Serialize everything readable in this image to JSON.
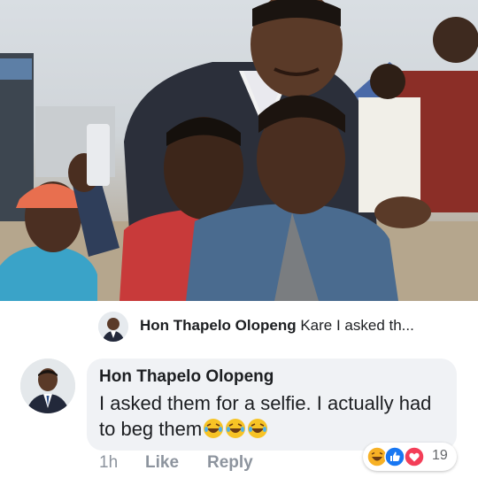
{
  "photo": {
    "icon": "selfie-photo"
  },
  "preview": {
    "author": "Hon Thapelo Olopeng",
    "snippet": "Kare I asked th..."
  },
  "comment": {
    "author": "Hon Thapelo Olopeng",
    "text": "I asked them for a selfie. I actually had to beg them",
    "emoji": [
      "laughing-emoji",
      "laughing-emoji",
      "laughing-emoji"
    ]
  },
  "actions": {
    "time": "1h",
    "like": "Like",
    "reply": "Reply"
  },
  "reactions": {
    "icons": [
      "haha-reaction-icon",
      "like-reaction-icon",
      "love-reaction-icon"
    ],
    "count": "19"
  },
  "colors": {
    "bubble": "#f0f2f5",
    "muted": "#8d949e",
    "like_blue": "#1877f2",
    "love_red": "#f33e58",
    "haha_yellow": "#f7b125"
  }
}
